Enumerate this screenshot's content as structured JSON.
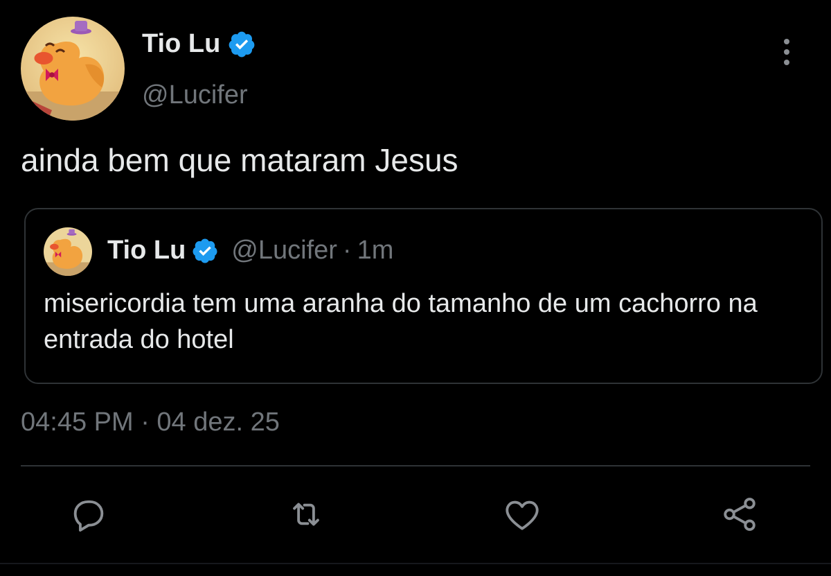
{
  "author": {
    "display_name": "Tio Lu",
    "handle": "@Lucifer",
    "verified": true
  },
  "tweet": {
    "text": "ainda bem que mataram Jesus",
    "timestamp": "04:45 PM · 04 dez. 25"
  },
  "quoted_tweet": {
    "display_name": "Tio Lu",
    "handle": "@Lucifer",
    "separator": "·",
    "time": "1m",
    "text": "misericordia tem uma aranha do tamanho de um cachorro na entrada do hotel"
  },
  "actions": [
    "reply-icon",
    "retweet-icon",
    "like-icon",
    "share-icon"
  ],
  "colors": {
    "background": "#000000",
    "primary_text": "#e7e9ea",
    "secondary_text": "#71767b",
    "border": "#2f3336",
    "verified_blue": "#1d9bf0"
  }
}
